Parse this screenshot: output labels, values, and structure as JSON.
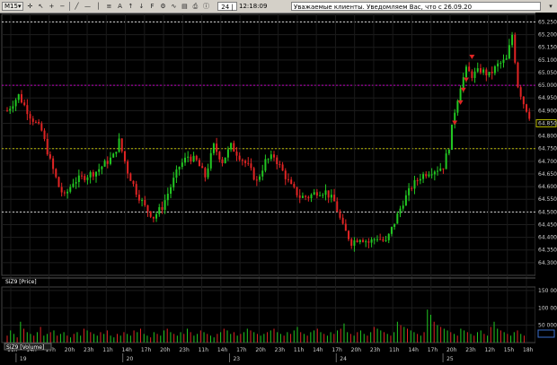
{
  "toolbar": {
    "timeframe": "M15",
    "counter": "24 | 24",
    "time": "12:18:09",
    "message": "Уважаемые клиенты. Уведомляем Вас, что с 26.09.20"
  },
  "price_panel": {
    "label": "SiZ9 [Price]",
    "last_price": "64.850"
  },
  "volume_panel": {
    "label": "SiZ9 [Volume]"
  },
  "colors": {
    "up": "#22c722",
    "down": "#e02424",
    "grid": "#6f6f6f",
    "magenta": "#c000c0",
    "olive": "#b8b800"
  },
  "chart_data": [
    {
      "type": "candlestick",
      "title": "SiZ9 [Price]",
      "ylim": [
        64250,
        65280
      ],
      "y_ticks": [
        "65.250",
        "65.200",
        "65.150",
        "65.100",
        "65.050",
        "65.000",
        "64.950",
        "64.900",
        "64.850",
        "64.800",
        "64.750",
        "64.700",
        "64.650",
        "64.600",
        "64.550",
        "64.500",
        "64.450",
        "64.400",
        "64.350",
        "64.300"
      ],
      "time_labels": [
        "11h",
        "14h",
        "17h",
        "20h",
        "23h",
        "11h",
        "14h",
        "17h",
        "20h",
        "23h",
        "11h",
        "14h",
        "17h",
        "20h",
        "23h",
        "11h",
        "14h",
        "17h",
        "20h",
        "23h",
        "11h",
        "14h",
        "17h",
        "20h",
        "23h",
        "12h",
        "15h",
        "18h"
      ],
      "day_labels": [
        "19",
        "20",
        "23",
        "24",
        "25"
      ],
      "horizontal_levels": [
        {
          "value": 65000,
          "color": "magenta"
        },
        {
          "value": 64750,
          "color": "olive"
        },
        {
          "value": 64500,
          "color": "white"
        },
        {
          "value": 65250,
          "color": "white"
        }
      ],
      "close_path": [
        [
          0,
          64900
        ],
        [
          4,
          64960
        ],
        [
          8,
          64880
        ],
        [
          12,
          64820
        ],
        [
          15,
          64700
        ],
        [
          18,
          64600
        ],
        [
          20,
          64560
        ],
        [
          23,
          64620
        ],
        [
          27,
          64640
        ],
        [
          31,
          64660
        ],
        [
          34,
          64690
        ],
        [
          37,
          64720
        ],
        [
          39,
          64780
        ],
        [
          42,
          64660
        ],
        [
          45,
          64580
        ],
        [
          48,
          64520
        ],
        [
          51,
          64480
        ],
        [
          54,
          64520
        ],
        [
          57,
          64600
        ],
        [
          60,
          64680
        ],
        [
          63,
          64720
        ],
        [
          66,
          64700
        ],
        [
          69,
          64640
        ],
        [
          72,
          64760
        ],
        [
          75,
          64700
        ],
        [
          78,
          64760
        ],
        [
          81,
          64720
        ],
        [
          84,
          64680
        ],
        [
          87,
          64620
        ],
        [
          90,
          64700
        ],
        [
          93,
          64720
        ],
        [
          96,
          64660
        ],
        [
          99,
          64600
        ],
        [
          102,
          64560
        ],
        [
          105,
          64560
        ],
        [
          108,
          64580
        ],
        [
          111,
          64580
        ],
        [
          114,
          64540
        ],
        [
          117,
          64440
        ],
        [
          120,
          64380
        ],
        [
          123,
          64400
        ],
        [
          126,
          64380
        ],
        [
          129,
          64400
        ],
        [
          132,
          64380
        ],
        [
          135,
          64460
        ],
        [
          138,
          64540
        ],
        [
          141,
          64600
        ],
        [
          144,
          64640
        ],
        [
          147,
          64660
        ],
        [
          150,
          64670
        ],
        [
          152,
          64680
        ],
        [
          154,
          64760
        ],
        [
          156,
          64900
        ],
        [
          158,
          65000
        ],
        [
          160,
          65060
        ],
        [
          162,
          65040
        ],
        [
          165,
          65060
        ],
        [
          168,
          65040
        ],
        [
          171,
          65080
        ],
        [
          174,
          65100
        ],
        [
          176,
          65200
        ],
        [
          178,
          65000
        ],
        [
          180,
          64930
        ],
        [
          182,
          64880
        ]
      ],
      "volume_ylim": [
        0,
        160000
      ],
      "volume_ticks": [
        "150 000",
        "100 000",
        "50 000"
      ],
      "volumes": [
        20,
        35,
        25,
        15,
        60,
        40,
        30,
        25,
        20,
        30,
        45,
        20,
        25,
        30,
        35,
        20,
        25,
        30,
        20,
        15,
        25,
        30,
        20,
        40,
        35,
        30,
        25,
        20,
        30,
        25,
        35,
        20,
        15,
        25,
        20,
        30,
        25,
        20,
        35,
        30,
        40,
        25,
        20,
        15,
        30,
        25,
        20,
        35,
        40,
        30,
        25,
        20,
        30,
        25,
        40,
        30,
        20,
        25,
        35,
        30,
        25,
        20,
        15,
        25,
        30,
        40,
        35,
        25,
        30,
        20,
        25,
        30,
        40,
        35,
        30,
        25,
        20,
        25,
        30,
        35,
        40,
        30,
        25,
        20,
        30,
        25,
        35,
        45,
        30,
        25,
        20,
        30,
        35,
        40,
        30,
        25,
        20,
        30,
        25,
        35,
        40,
        55,
        30,
        25,
        20,
        30,
        35,
        25,
        20,
        30,
        45,
        40,
        35,
        30,
        25,
        20,
        30,
        60,
        50,
        45,
        40,
        35,
        30,
        25,
        20,
        30,
        95,
        80,
        60,
        50,
        45,
        40,
        35,
        30,
        25,
        20,
        40,
        35,
        30,
        25,
        20,
        30,
        35,
        25,
        20,
        45,
        60,
        40,
        35,
        30,
        25,
        20,
        30,
        35,
        25,
        20
      ]
    }
  ]
}
